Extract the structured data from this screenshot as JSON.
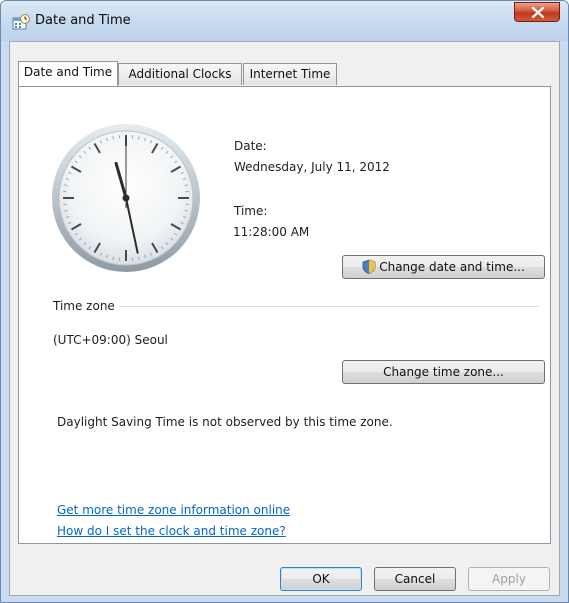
{
  "window": {
    "title": "Date and Time"
  },
  "tabs": [
    {
      "label": "Date and Time",
      "active": true
    },
    {
      "label": "Additional Clocks",
      "active": false
    },
    {
      "label": "Internet Time",
      "active": false
    }
  ],
  "clock": {
    "hour": 11,
    "minute": 28,
    "second": 0
  },
  "date": {
    "label": "Date:",
    "value": "Wednesday, July 11, 2012"
  },
  "time": {
    "label": "Time:",
    "value": "11:28:00 AM"
  },
  "buttons": {
    "change_date_time": "Change date and time...",
    "change_time_zone": "Change time zone...",
    "ok": "OK",
    "cancel": "Cancel",
    "apply": "Apply"
  },
  "timezone": {
    "group_label": "Time zone",
    "value": "(UTC+09:00) Seoul",
    "dst_note": "Daylight Saving Time is not observed by this time zone."
  },
  "links": [
    "Get more time zone information online",
    "How do I set the clock and time zone?"
  ],
  "colors": {
    "link": "#0066cc",
    "close_button": "#c94a2d",
    "titlebar": "#c6daef"
  }
}
